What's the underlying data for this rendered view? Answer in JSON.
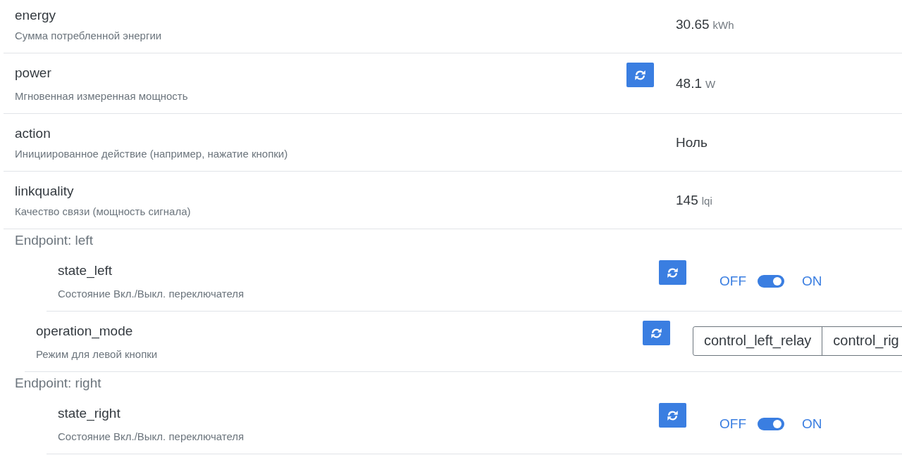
{
  "features": [
    {
      "kind": "reading",
      "name": "energy",
      "description": "Сумма потребленной энергии",
      "value": "30.65",
      "unit": "kWh"
    },
    {
      "kind": "reading",
      "name": "power",
      "description": "Мгновенная измеренная мощность",
      "refresh": true,
      "value": "48.1",
      "unit": "W"
    },
    {
      "kind": "reading",
      "name": "action",
      "description": "Инициированное действие (например, нажатие кнопки)",
      "value": "Ноль"
    },
    {
      "kind": "reading",
      "name": "linkquality",
      "description": "Качество связи (мощность сигнала)",
      "value": "145",
      "unit": "lqi"
    }
  ],
  "endpoints": [
    {
      "label": "Endpoint: left",
      "features": [
        {
          "kind": "toggle",
          "name": "state_left",
          "description": "Состояние Вкл./Выкл. переключателя",
          "refresh": true,
          "off_label": "OFF",
          "on_label": "ON",
          "on": true
        },
        {
          "kind": "options",
          "name": "operation_mode",
          "description": "Режим для левой кнопки",
          "refresh": true,
          "options": [
            {
              "label": "control_left_relay",
              "selected": false
            },
            {
              "label": "control_rig",
              "selected": false
            }
          ]
        }
      ]
    },
    {
      "label": "Endpoint: right",
      "features": [
        {
          "kind": "toggle",
          "name": "state_right",
          "description": "Состояние Вкл./Выкл. переключателя",
          "refresh": true,
          "off_label": "OFF",
          "on_label": "ON",
          "on": true
        }
      ]
    }
  ]
}
